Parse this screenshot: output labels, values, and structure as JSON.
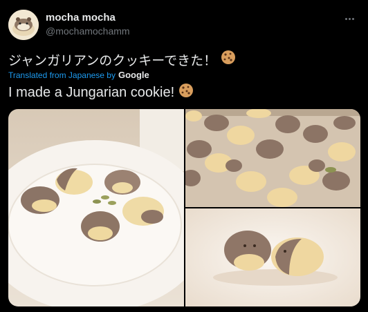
{
  "author": {
    "name": "mocha mocha",
    "handle": "@mochamochamm"
  },
  "tweet": {
    "original_text": "ジャンガリアンのクッキーできた！",
    "translated_label": "Translated from Japanese by",
    "translator": "Google",
    "translated_text": "I made a Jungarian cookie!"
  },
  "icons": {
    "more": "more-options-icon",
    "emoji": "cookie-emoji-icon"
  },
  "colors": {
    "background": "#000000",
    "text": "#e7e9ea",
    "muted": "#71767b",
    "link": "#1d9bf0"
  }
}
